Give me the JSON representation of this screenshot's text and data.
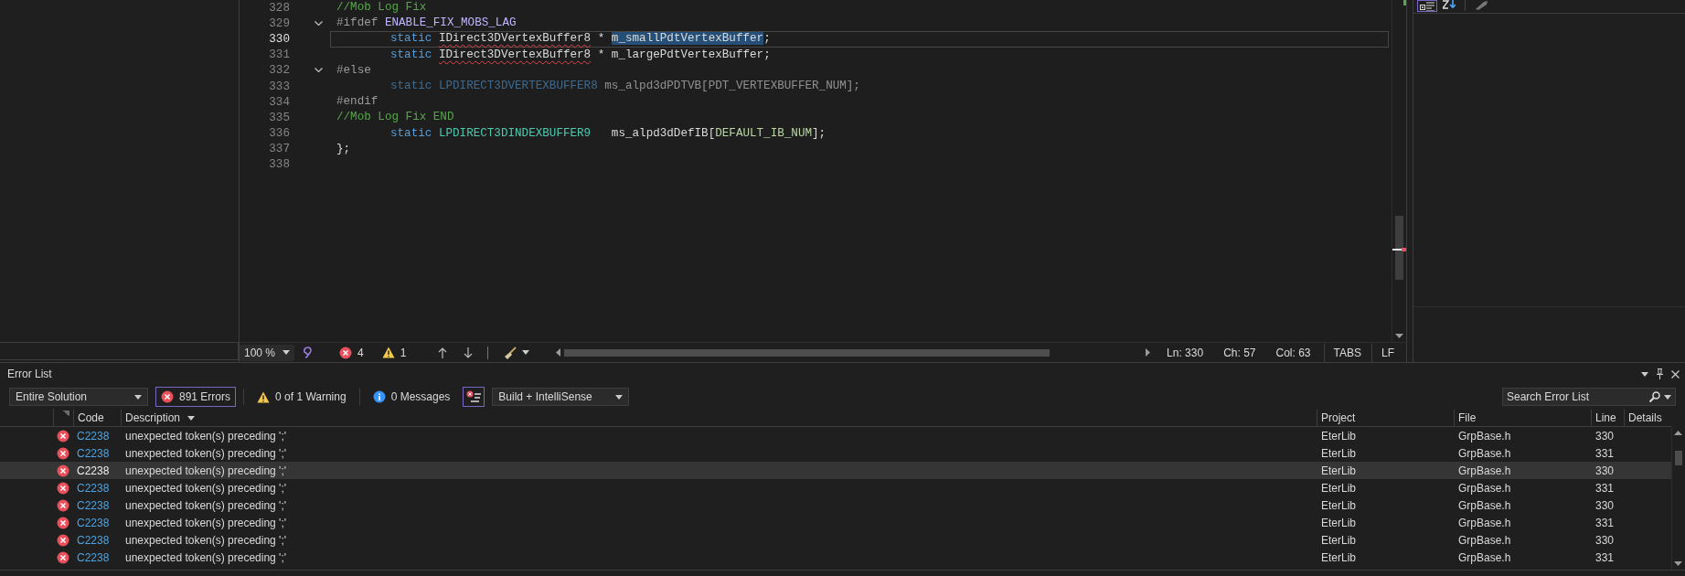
{
  "editor": {
    "lines": [
      {
        "number": "328",
        "current": false,
        "inactive": false,
        "indented": false,
        "fold_toggle": false,
        "tokens": [
          {
            "text": "//Mob Log Fix",
            "kind": "comment"
          }
        ]
      },
      {
        "number": "329",
        "current": false,
        "inactive": false,
        "indented": false,
        "fold_toggle": true,
        "tokens": [
          {
            "text": "#ifdef ",
            "kind": "preproc"
          },
          {
            "text": "ENABLE_FIX_MOBS_LAG",
            "kind": "macro"
          }
        ]
      },
      {
        "number": "330",
        "current": true,
        "inactive": false,
        "indented": true,
        "fold_toggle": false,
        "tokens": [
          {
            "text": "static ",
            "kind": "keyword"
          },
          {
            "text": "IDirect3DVertexBuffer8",
            "kind": "unresolved"
          },
          {
            "text": " * ",
            "kind": "plain"
          },
          {
            "text": "m_smallPdtVertexBuffer",
            "kind": "selection"
          },
          {
            "text": ";",
            "kind": "plain"
          }
        ]
      },
      {
        "number": "331",
        "current": false,
        "inactive": false,
        "indented": true,
        "fold_toggle": false,
        "tokens": [
          {
            "text": "static ",
            "kind": "keyword"
          },
          {
            "text": "IDirect3DVertexBuffer8",
            "kind": "unresolved"
          },
          {
            "text": " * ",
            "kind": "plain"
          },
          {
            "text": "m_largePdtVertexBuffer",
            "kind": "plain"
          },
          {
            "text": ";",
            "kind": "plain"
          }
        ]
      },
      {
        "number": "332",
        "current": false,
        "inactive": false,
        "indented": false,
        "fold_toggle": true,
        "tokens": [
          {
            "text": "#else",
            "kind": "preproc"
          }
        ]
      },
      {
        "number": "333",
        "current": false,
        "inactive": true,
        "indented": true,
        "fold_toggle": false,
        "tokens": [
          {
            "text": "static ",
            "kind": "keyword"
          },
          {
            "text": "LPDIRECT3DVERTEXBUFFER8",
            "kind": "typedef"
          },
          {
            "text": " ms_alpd3dPDTVB[PDT_VERTEXBUFFER_NUM];",
            "kind": "plain"
          }
        ]
      },
      {
        "number": "334",
        "current": false,
        "inactive": false,
        "indented": false,
        "fold_toggle": false,
        "tokens": [
          {
            "text": "#endif",
            "kind": "preproc"
          }
        ]
      },
      {
        "number": "335",
        "current": false,
        "inactive": false,
        "indented": false,
        "fold_toggle": false,
        "tokens": [
          {
            "text": "//Mob Log Fix END",
            "kind": "comment"
          }
        ]
      },
      {
        "number": "336",
        "current": false,
        "inactive": false,
        "indented": true,
        "fold_toggle": false,
        "tokens": [
          {
            "text": "static ",
            "kind": "keyword"
          },
          {
            "text": "LPDIRECT3DINDEXBUFFER9",
            "kind": "type"
          },
          {
            "text": "   ms_alpd3dDefIB[",
            "kind": "plain"
          },
          {
            "text": "DEFAULT_IB_NUM",
            "kind": "enum"
          },
          {
            "text": "];",
            "kind": "plain"
          }
        ]
      },
      {
        "number": "337",
        "current": false,
        "inactive": false,
        "indented": false,
        "fold_toggle": false,
        "tokens": [
          {
            "text": "};",
            "kind": "plain"
          }
        ]
      },
      {
        "number": "338",
        "current": false,
        "fold_toggle": false
      }
    ]
  },
  "status_bar": {
    "zoom": "100 %",
    "errors": "4",
    "warnings": "1",
    "line": "Ln: 330",
    "char": "Ch: 57",
    "column": "Col: 63",
    "indentation": "TABS",
    "line_ending": "LF"
  },
  "error_list": {
    "title": "Error List",
    "scope": "Entire Solution",
    "filters": [
      {
        "label": "891 Errors",
        "kind": "error",
        "selected": true
      },
      {
        "label": "0 of 1 Warning",
        "kind": "warning",
        "selected": false
      },
      {
        "label": "0 Messages",
        "kind": "message",
        "selected": false
      }
    ],
    "filter_toggle": {
      "on": true
    },
    "source": "Build + IntelliSense",
    "search": {
      "placeholder": "Search Error List"
    },
    "columns": [
      "Code",
      "Description",
      "Project",
      "File",
      "Line",
      "Details"
    ],
    "rows": [
      {
        "code": "C2238",
        "description": "unexpected token(s) preceding ';'",
        "project": "EterLib",
        "file": "GrpBase.h",
        "line": "330",
        "selected": false
      },
      {
        "code": "C2238",
        "description": "unexpected token(s) preceding ';'",
        "project": "EterLib",
        "file": "GrpBase.h",
        "line": "331",
        "selected": false
      },
      {
        "code": "C2238",
        "description": "unexpected token(s) preceding ';'",
        "project": "EterLib",
        "file": "GrpBase.h",
        "line": "330",
        "selected": true
      },
      {
        "code": "C2238",
        "description": "unexpected token(s) preceding ';'",
        "project": "EterLib",
        "file": "GrpBase.h",
        "line": "331",
        "selected": false
      },
      {
        "code": "C2238",
        "description": "unexpected token(s) preceding ';'",
        "project": "EterLib",
        "file": "GrpBase.h",
        "line": "330",
        "selected": false
      },
      {
        "code": "C2238",
        "description": "unexpected token(s) preceding ';'",
        "project": "EterLib",
        "file": "GrpBase.h",
        "line": "331",
        "selected": false
      },
      {
        "code": "C2238",
        "description": "unexpected token(s) preceding ';'",
        "project": "EterLib",
        "file": "GrpBase.h",
        "line": "330",
        "selected": false
      },
      {
        "code": "C2238",
        "description": "unexpected token(s) preceding ';'",
        "project": "EterLib",
        "file": "GrpBase.h",
        "line": "331",
        "selected": false
      }
    ]
  }
}
